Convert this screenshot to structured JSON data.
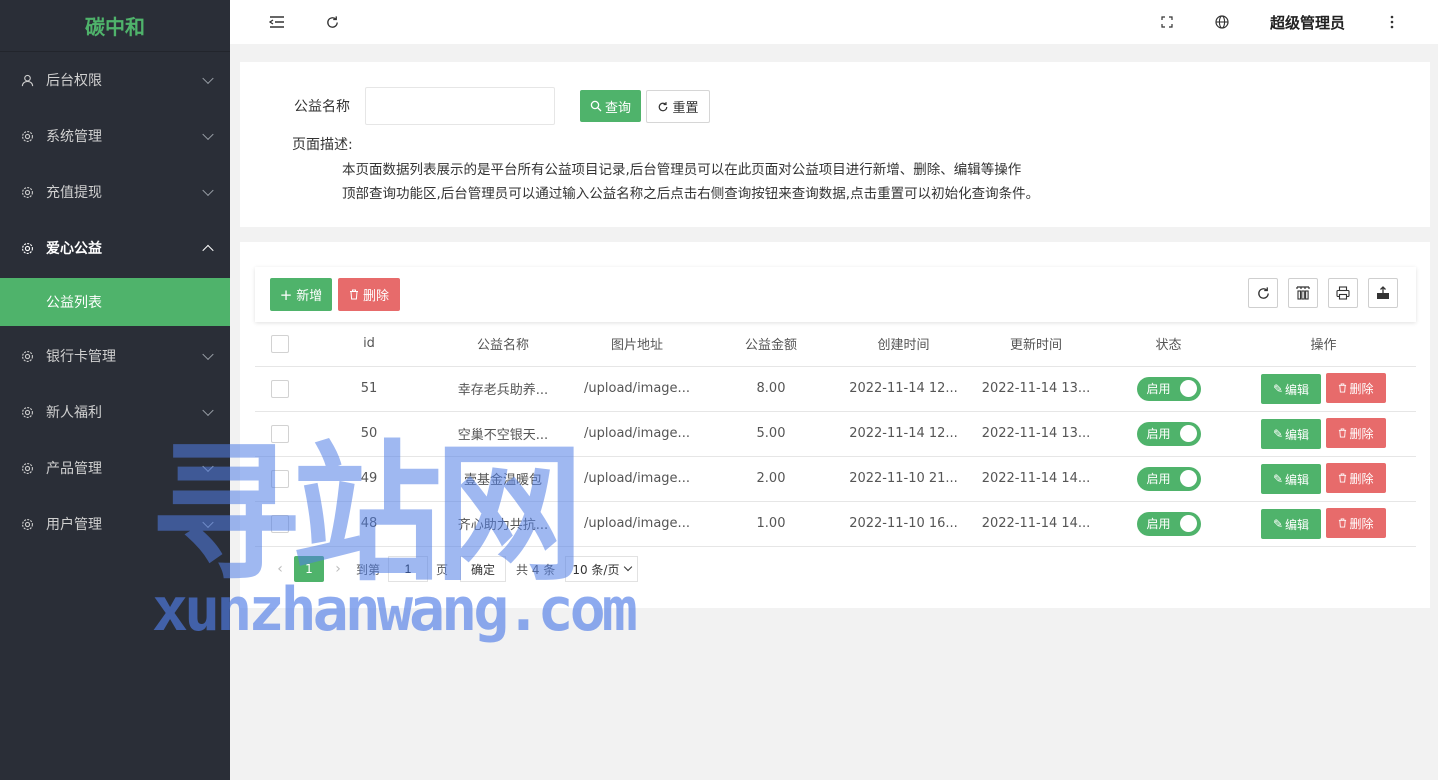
{
  "app": {
    "logo": "碳中和"
  },
  "sidebar": {
    "items": [
      {
        "label": "后台权限",
        "icon": "user-icon"
      },
      {
        "label": "系统管理",
        "icon": "gear-icon"
      },
      {
        "label": "充值提现",
        "icon": "gear-icon"
      },
      {
        "label": "爱心公益",
        "icon": "gear-icon",
        "open": true
      },
      {
        "label": "银行卡管理",
        "icon": "gear-icon"
      },
      {
        "label": "新人福利",
        "icon": "gear-icon"
      },
      {
        "label": "产品管理",
        "icon": "gear-icon"
      },
      {
        "label": "用户管理",
        "icon": "gear-icon"
      }
    ],
    "sub_active": "公益列表"
  },
  "topbar": {
    "admin": "超级管理员",
    "icons": [
      "menu-fold-icon",
      "refresh-icon",
      "fullscreen-icon",
      "globe-icon",
      "more-vertical-icon"
    ]
  },
  "search": {
    "label": "公益名称",
    "value": "",
    "query_label": "查询",
    "reset_label": "重置",
    "desc_title": "页面描述:",
    "desc_line1": "本页面数据列表展示的是平台所有公益项目记录,后台管理员可以在此页面对公益项目进行新增、删除、编辑等操作",
    "desc_line2": "顶部查询功能区,后台管理员可以通过输入公益名称之后点击右侧查询按钮来查询数据,点击重置可以初始化查询条件。"
  },
  "toolbar": {
    "add_label": "新增",
    "delete_label": "删除",
    "tools": [
      "refresh-icon",
      "columns-icon",
      "print-icon",
      "export-icon"
    ]
  },
  "table": {
    "headers": [
      "id",
      "公益名称",
      "图片地址",
      "公益金额",
      "创建时间",
      "更新时间",
      "状态",
      "操作"
    ],
    "rows": [
      {
        "id": "51",
        "name": "幸存老兵助养...",
        "image": "/upload/image...",
        "amount": "8.00",
        "created": "2022-11-14 12...",
        "updated": "2022-11-14 13...",
        "status": "启用"
      },
      {
        "id": "50",
        "name": "空巢不空银天...",
        "image": "/upload/image...",
        "amount": "5.00",
        "created": "2022-11-14 12...",
        "updated": "2022-11-14 13...",
        "status": "启用"
      },
      {
        "id": "49",
        "name": "壹基金温暖包",
        "image": "/upload/image...",
        "amount": "2.00",
        "created": "2022-11-10 21...",
        "updated": "2022-11-14 14...",
        "status": "启用"
      },
      {
        "id": "48",
        "name": "齐心助力共抗...",
        "image": "/upload/image...",
        "amount": "1.00",
        "created": "2022-11-10 16...",
        "updated": "2022-11-14 14...",
        "status": "启用"
      }
    ],
    "edit_label": "编辑",
    "delete_label": "删除"
  },
  "pager": {
    "current": "1",
    "goto_label": "到第",
    "goto_value": "1",
    "page_label": "页",
    "confirm_label": "确定",
    "total_label": "共 4 条",
    "size_label": "10 条/页"
  },
  "watermark": {
    "cn": "寻站网",
    "en": "xunzhanwang.com"
  },
  "colors": {
    "primary": "#4fb36b",
    "danger": "#e76b6b",
    "sidebar_bg": "#2a2e37"
  }
}
